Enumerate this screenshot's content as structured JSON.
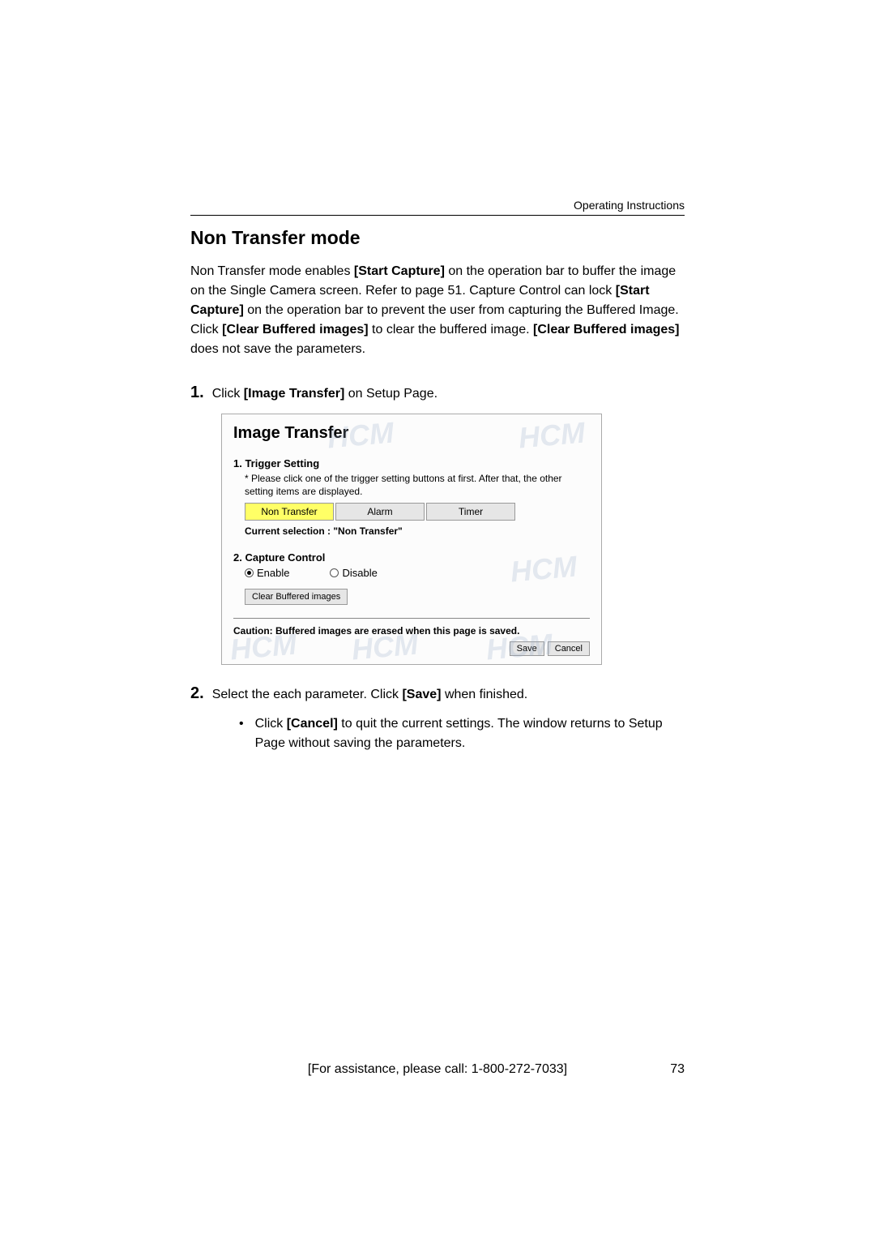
{
  "header": {
    "label": "Operating Instructions"
  },
  "section": {
    "title": "Non Transfer mode"
  },
  "intro": {
    "part1": "Non Transfer mode enables ",
    "bold1": "[Start Capture]",
    "part2": " on the operation bar to buffer the image on the Single Camera screen. Refer to page 51. Capture Control can lock ",
    "bold2": "[Start Capture]",
    "part3": " on the operation bar to prevent the user from capturing the Buffered Image. Click ",
    "bold3": "[Clear Buffered images]",
    "part4": " to clear the buffered image. ",
    "bold4": "[Clear Buffered images]",
    "part5": " does not save the parameters."
  },
  "step1": {
    "num": "1.",
    "pre": "Click ",
    "bold": "[Image Transfer]",
    "post": " on Setup Page."
  },
  "ui": {
    "title": "Image Transfer",
    "section1_label": "1.  Trigger Setting",
    "note": "* Please click one of the trigger setting buttons at first. After that, the other setting items are displayed.",
    "btn_non_transfer": "Non Transfer",
    "btn_alarm": "Alarm",
    "btn_timer": "Timer",
    "current_selection": "Current selection : \"Non Transfer\"",
    "section2_label": "2.  Capture Control",
    "radio_enable": "Enable",
    "radio_disable": "Disable",
    "clear_btn": "Clear Buffered images",
    "caution": "Caution: Buffered images are erased when this page is saved.",
    "save": "Save",
    "cancel": "Cancel",
    "watermark": "HCM"
  },
  "step2": {
    "num": "2.",
    "pre": "Select the each parameter. Click ",
    "bold": "[Save]",
    "post": " when finished."
  },
  "bullet": {
    "dot": "•",
    "pre": "Click ",
    "bold": "[Cancel]",
    "post": " to quit the current settings. The window returns to Setup Page without saving the parameters."
  },
  "footer": {
    "text": "[For assistance, please call: 1-800-272-7033]",
    "page": "73"
  }
}
